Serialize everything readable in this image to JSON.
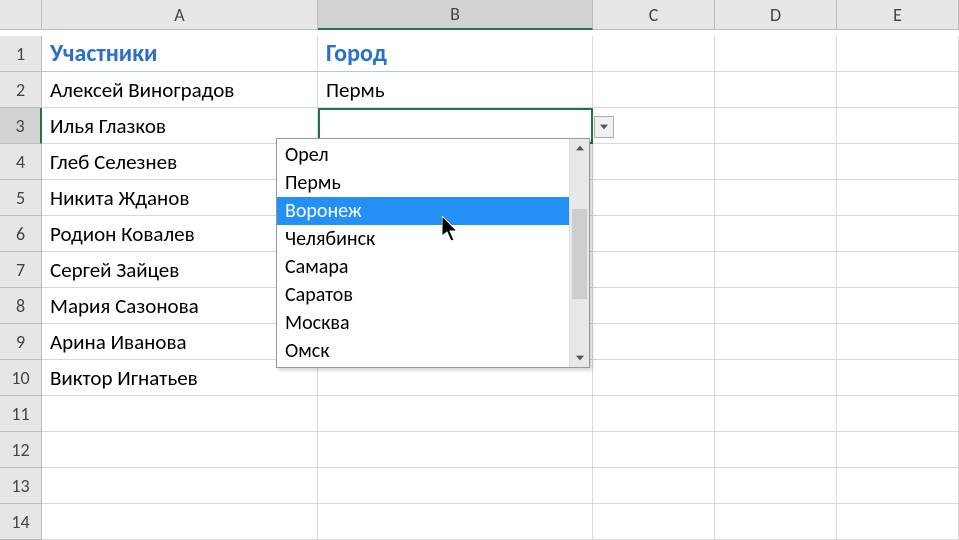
{
  "columns": [
    "A",
    "B",
    "C",
    "D",
    "E"
  ],
  "rows": [
    "1",
    "2",
    "3",
    "4",
    "5",
    "6",
    "7",
    "8",
    "9",
    "10",
    "11",
    "12",
    "13",
    "14"
  ],
  "active_cell": {
    "row": 3,
    "col": "B"
  },
  "table": {
    "headers": {
      "A": "Участники",
      "B": "Город"
    },
    "data": [
      {
        "A": "Алексей Виноградов",
        "B": "Пермь"
      },
      {
        "A": "Илья Глазков",
        "B": ""
      },
      {
        "A": "Глеб Селезнев",
        "B": ""
      },
      {
        "A": "Никита Жданов",
        "B": ""
      },
      {
        "A": "Родион Ковалев",
        "B": ""
      },
      {
        "A": "Сергей Зайцев",
        "B": ""
      },
      {
        "A": "Мария Сазонова",
        "B": ""
      },
      {
        "A": "Арина Иванова",
        "B": ""
      },
      {
        "A": "Виктор Игнатьев",
        "B": ""
      }
    ]
  },
  "dropdown": {
    "open": true,
    "highlighted": "Воронеж",
    "items": [
      "Орел",
      "Пермь",
      "Воронеж",
      "Челябинск",
      "Самара",
      "Саратов",
      "Москва",
      "Омск"
    ]
  }
}
